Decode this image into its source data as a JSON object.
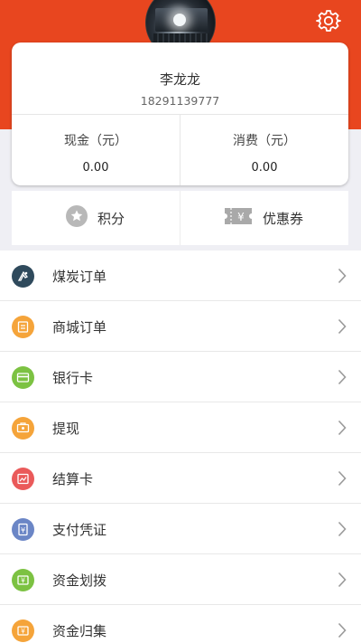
{
  "profile": {
    "name": "李龙龙",
    "phone": "18291139777"
  },
  "balances": [
    {
      "label": "现金（元）",
      "value": "0.00"
    },
    {
      "label": "消费（元）",
      "value": "0.00"
    }
  ],
  "quick_actions": [
    {
      "label": "积分",
      "icon": "star-icon"
    },
    {
      "label": "优惠券",
      "icon": "coupon-icon"
    }
  ],
  "menu": [
    {
      "label": "煤炭订单",
      "icon": "coal-order-icon",
      "color": "#2f4a5c"
    },
    {
      "label": "商城订单",
      "icon": "mall-order-icon",
      "color": "#f5a43a"
    },
    {
      "label": "银行卡",
      "icon": "bank-card-icon",
      "color": "#7cc242"
    },
    {
      "label": "提现",
      "icon": "withdraw-icon",
      "color": "#f5a43a"
    },
    {
      "label": "结算卡",
      "icon": "settlement-card-icon",
      "color": "#ea5a5a"
    },
    {
      "label": "支付凭证",
      "icon": "payment-voucher-icon",
      "color": "#6b86c6"
    },
    {
      "label": "资金划拨",
      "icon": "fund-transfer-icon",
      "color": "#7cc242"
    },
    {
      "label": "资金归集",
      "icon": "fund-collection-icon",
      "color": "#f5a43a"
    }
  ],
  "colors": {
    "header": "#e8461f",
    "background": "#efeff4"
  }
}
